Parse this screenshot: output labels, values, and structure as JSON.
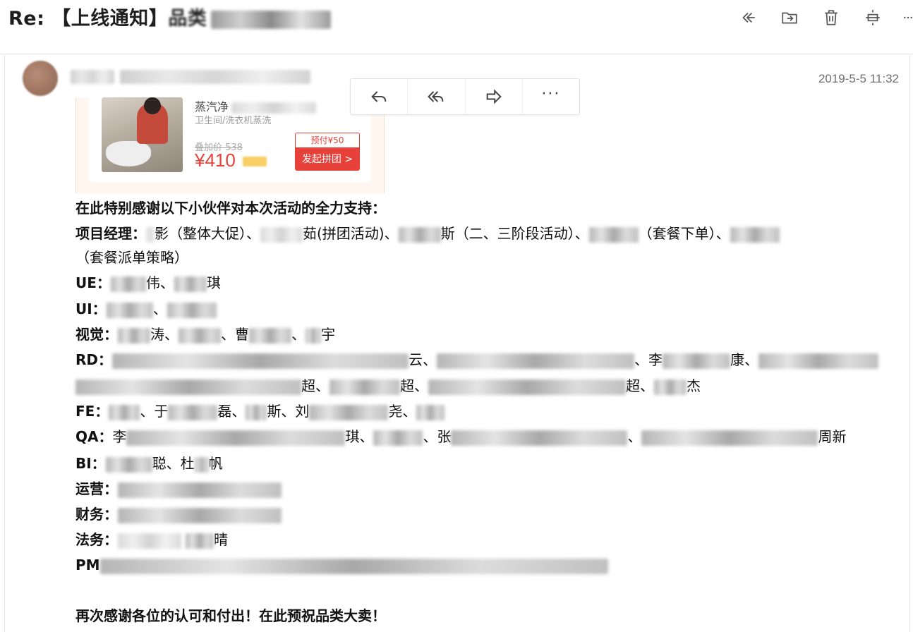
{
  "subject": {
    "prefix": "Re: 【上线通知】",
    "visible_fragment": "品类"
  },
  "toolbar": [
    "reply-all-icon",
    "move-to-folder-icon",
    "delete-icon",
    "collapse-icon",
    "more-icon"
  ],
  "sender": {
    "timestamp": "2019-5-5 11:32"
  },
  "action_popover": [
    "reply-icon",
    "reply-all-icon",
    "forward-icon",
    "more-icon"
  ],
  "promo_card": {
    "title": "蒸汽净",
    "subtitle": "卫生间/洗衣机蒸洗",
    "original_price": "叠加价 538",
    "price": "¥410",
    "prepay": "预付¥50",
    "group_button": "发起拼团 >"
  },
  "message": {
    "thanks_line": "在此特别感谢以下小伙伴对本次活动的全力支持：",
    "pm_line1": {
      "label": "项目经理：",
      "t1": "影（整体大促）、",
      "t2": "茹(拼团活动)、",
      "t3": "斯（二、三阶段活动）、",
      "t4": "（套餐下单）、"
    },
    "pm_line2": "（套餐派单策略）",
    "ue": {
      "label": "UE：",
      "t1": "伟、",
      "t2": "琪"
    },
    "ui": {
      "label": "UI：",
      "t1": "、"
    },
    "visual": {
      "label": "视觉：",
      "t1": "涛、",
      "t2": "、曹",
      "t3": "、",
      "t4": "宇"
    },
    "rd_line1": {
      "label": "RD：",
      "t1": "云、",
      "t2": "、李",
      "t3": "康、"
    },
    "rd_line2": {
      "t1": "超、",
      "t2": "超、",
      "t3": "超、",
      "t4": "杰"
    },
    "fe": {
      "label": "FE：",
      "t1": "、于",
      "t2": "磊、",
      "t3": "斯、刘",
      "t4": "尧、"
    },
    "qa": {
      "label": "QA：",
      "t1": "李",
      "t2": "琪、",
      "t3": "、张",
      "t4": "、",
      "t5": "周新"
    },
    "bi": {
      "label": "BI：",
      "t1": "聪、杜",
      "t2": "帆"
    },
    "ops": {
      "label": "运营："
    },
    "finance": {
      "label": "财务："
    },
    "legal": {
      "label": "法务：",
      "t1": "晴"
    },
    "pmo": {
      "label": "PM"
    },
    "closing": "再次感谢各位的认可和付出！在此预祝品类大卖！"
  }
}
